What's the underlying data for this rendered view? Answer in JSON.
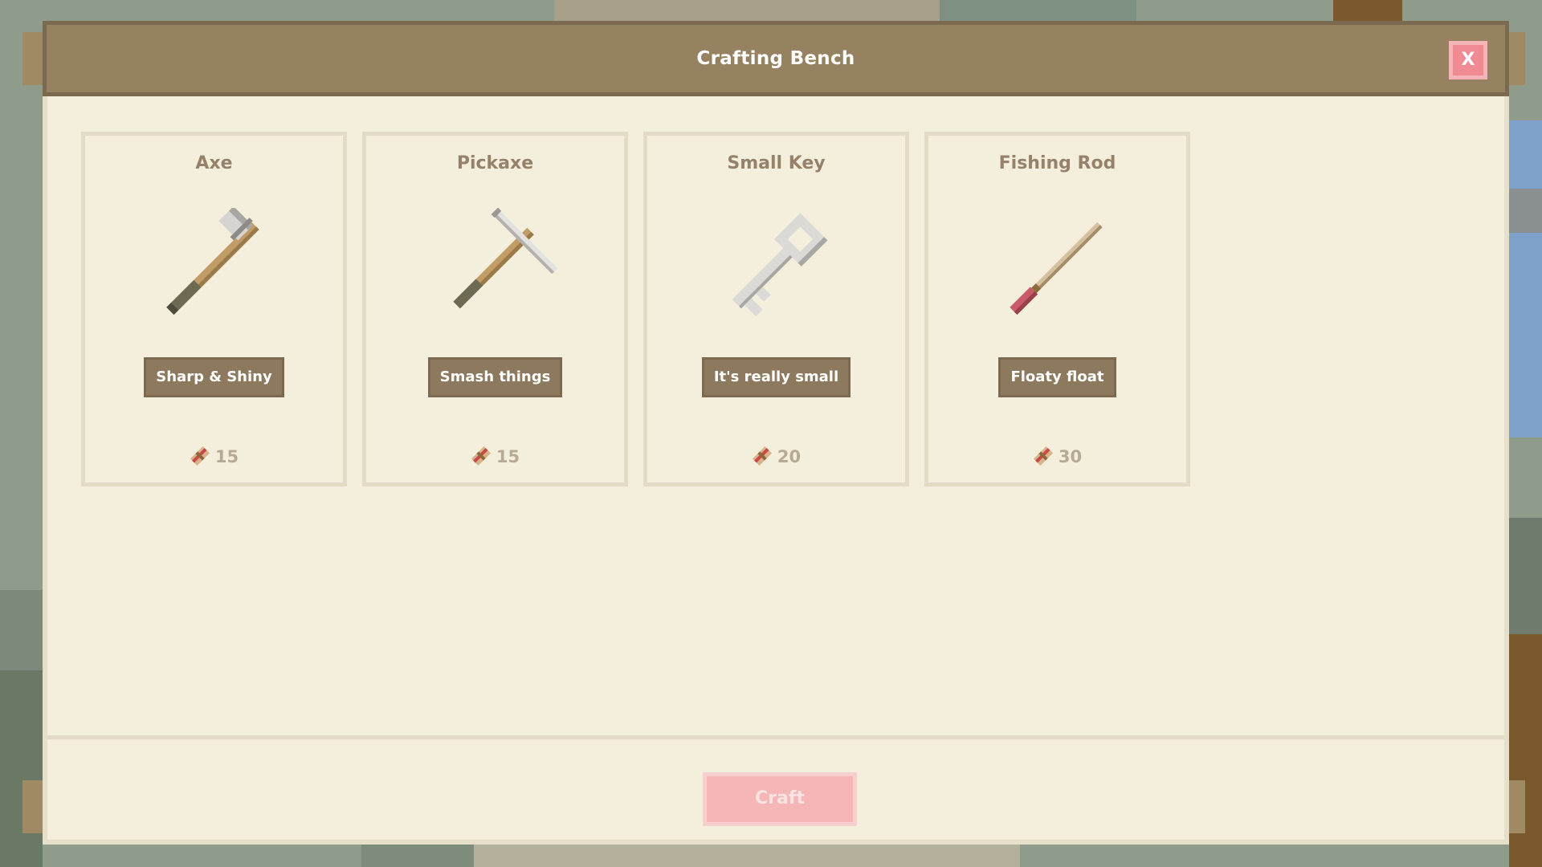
{
  "window": {
    "title": "Crafting Bench",
    "close_label": "X"
  },
  "items": [
    {
      "name": "Axe",
      "description": "Sharp & Shiny",
      "cost": "15",
      "icon": "axe-icon"
    },
    {
      "name": "Pickaxe",
      "description": "Smash things",
      "cost": "15",
      "icon": "pickaxe-icon"
    },
    {
      "name": "Small Key",
      "description": "It's really small",
      "cost": "20",
      "icon": "key-icon"
    },
    {
      "name": "Fishing Rod",
      "description": "Floaty float",
      "cost": "30",
      "icon": "fishing-rod-icon"
    }
  ],
  "cost_icon": "material-bundle-icon",
  "footer": {
    "craft_label": "Craft",
    "craft_enabled": false
  },
  "colors": {
    "header": "#968161",
    "panel": "#f4efdd",
    "tag": "#8d7a5e",
    "close": "#f08a93",
    "craft_disabled": "#f4b6b7"
  }
}
